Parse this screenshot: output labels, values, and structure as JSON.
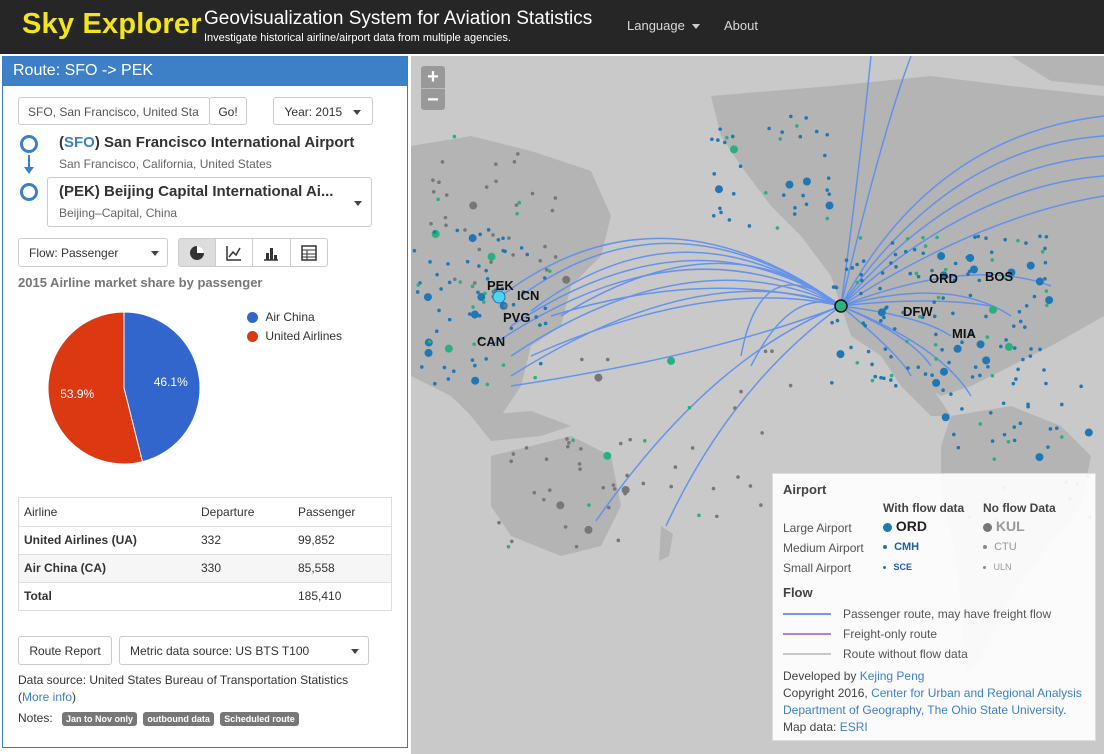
{
  "nav": {
    "brand": "Sky Explorer",
    "title": "Geovisualization System for Aviation Statistics",
    "subtitle": "Investigate historical airline/airport data from multiple agencies.",
    "language": "Language",
    "about": "About"
  },
  "panel": {
    "header": "Route: SFO -> PEK",
    "search_value": "SFO, San Francisco, United Sta",
    "go": "Go!",
    "year": "Year: 2015",
    "origin": {
      "code": "SFO",
      "name": " San Francisco International Airport",
      "city": "San Francisco, California, United States"
    },
    "destination": {
      "code": "PEK",
      "name": "(PEK) Beijing Capital International Ai...",
      "city": "Beijing–Capital, China"
    },
    "flow": "Flow: Passenger",
    "chart_icons": [
      "pie-chart-icon",
      "line-chart-icon",
      "bar-chart-icon",
      "table-icon"
    ],
    "chart_title": "2015 Airline market share by passenger",
    "table": {
      "headers": [
        "Airline",
        "Departure",
        "Passenger"
      ],
      "rows": [
        [
          "United Airlines (UA)",
          "332",
          "99,852"
        ],
        [
          "Air China (CA)",
          "330",
          "85,558"
        ],
        [
          "Total",
          "",
          "185,410"
        ]
      ]
    },
    "route_report": "Route Report",
    "metric_source": "Metric data source: US BTS T100",
    "data_source": "Data source: United States Bureau of Transportation Statistics",
    "more_info_open": "(",
    "more_info": "More info",
    "more_info_close": ")",
    "notes_label": "Notes:",
    "notes": [
      "Jan to Nov only",
      "outbound data",
      "Scheduled route"
    ]
  },
  "chart_data": {
    "type": "pie",
    "title": "2015 Airline market share by passenger",
    "series": [
      {
        "name": "Air China",
        "value": 46.1,
        "label": "46.1%",
        "color": "#3366cc"
      },
      {
        "name": "United Airlines",
        "value": 53.9,
        "label": "53.9%",
        "color": "#dc3912"
      }
    ]
  },
  "map": {
    "labels_big": [
      "PEK",
      "ICN",
      "PVG",
      "CAN",
      "ORD",
      "BOS",
      "MIA",
      "DFW"
    ],
    "legend": {
      "airport_title": "Airport",
      "with_flow": "With flow data",
      "no_flow": "No flow Data",
      "large": "Large Airport",
      "medium": "Medium Airport",
      "small": "Small Airport",
      "ex_large": "ORD",
      "ex_large_nf": "KUL",
      "ex_medium": "CMH",
      "ex_medium_nf": "CTU",
      "ex_small": "SCE",
      "ex_small_nf": "ULN",
      "flow_title": "Flow",
      "passenger_route": "Passenger route, may have freight flow",
      "freight_route": "Freight-only route",
      "no_flow_route": "Route without flow data",
      "developed_by": "Developed by ",
      "developer": "Kejing Peng",
      "copyright": "Copyright 2016, ",
      "center": "Center for Urban and Regional Analysis",
      "dept": "Department of Geography, The Ohio State University",
      "map_data": "Map data: ",
      "esri": "ESRI",
      "colors": {
        "passenger": "#6f9cf0",
        "freight": "#b07cf0",
        "noflow": "#c8c8c8"
      }
    }
  }
}
